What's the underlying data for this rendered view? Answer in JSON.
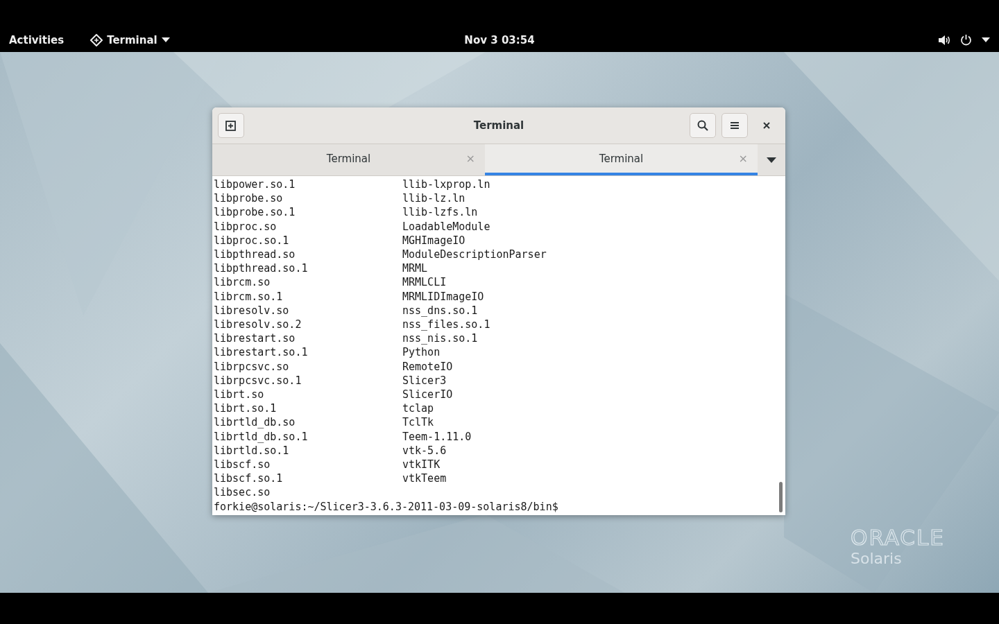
{
  "top_bar": {
    "activities": "Activities",
    "app_menu": "Terminal",
    "clock": "Nov 3  03:54"
  },
  "window": {
    "title": "Terminal",
    "tabs": [
      {
        "label": "Terminal",
        "close": "×",
        "selected": false
      },
      {
        "label": "Terminal",
        "close": "×",
        "selected": true
      }
    ],
    "terminal": {
      "rows": [
        [
          "libpower.so.1",
          "llib-lxprop.ln"
        ],
        [
          "libprobe.so",
          "llib-lz.ln"
        ],
        [
          "libprobe.so.1",
          "llib-lzfs.ln"
        ],
        [
          "libproc.so",
          "LoadableModule"
        ],
        [
          "libproc.so.1",
          "MGHImageIO"
        ],
        [
          "libpthread.so",
          "ModuleDescriptionParser"
        ],
        [
          "libpthread.so.1",
          "MRML"
        ],
        [
          "librcm.so",
          "MRMLCLI"
        ],
        [
          "librcm.so.1",
          "MRMLIDImageIO"
        ],
        [
          "libresolv.so",
          "nss_dns.so.1"
        ],
        [
          "libresolv.so.2",
          "nss_files.so.1"
        ],
        [
          "librestart.so",
          "nss_nis.so.1"
        ],
        [
          "librestart.so.1",
          "Python"
        ],
        [
          "librpcsvc.so",
          "RemoteIO"
        ],
        [
          "librpcsvc.so.1",
          "Slicer3"
        ],
        [
          "librt.so",
          "SlicerIO"
        ],
        [
          "librt.so.1",
          "tclap"
        ],
        [
          "librtld_db.so",
          "TclTk"
        ],
        [
          "librtld_db.so.1",
          "Teem-1.11.0"
        ],
        [
          "librtld.so.1",
          "vtk-5.6"
        ],
        [
          "libscf.so",
          "vtkITK"
        ],
        [
          "libscf.so.1",
          "vtkTeem"
        ],
        [
          "libsec.so"
        ]
      ],
      "prompt": "forkie@solaris:~/Slicer3-3.6.3-2011-03-09-solaris8/bin$"
    }
  },
  "wallpaper": {
    "brand": "ORACLE",
    "product": "Solaris"
  }
}
